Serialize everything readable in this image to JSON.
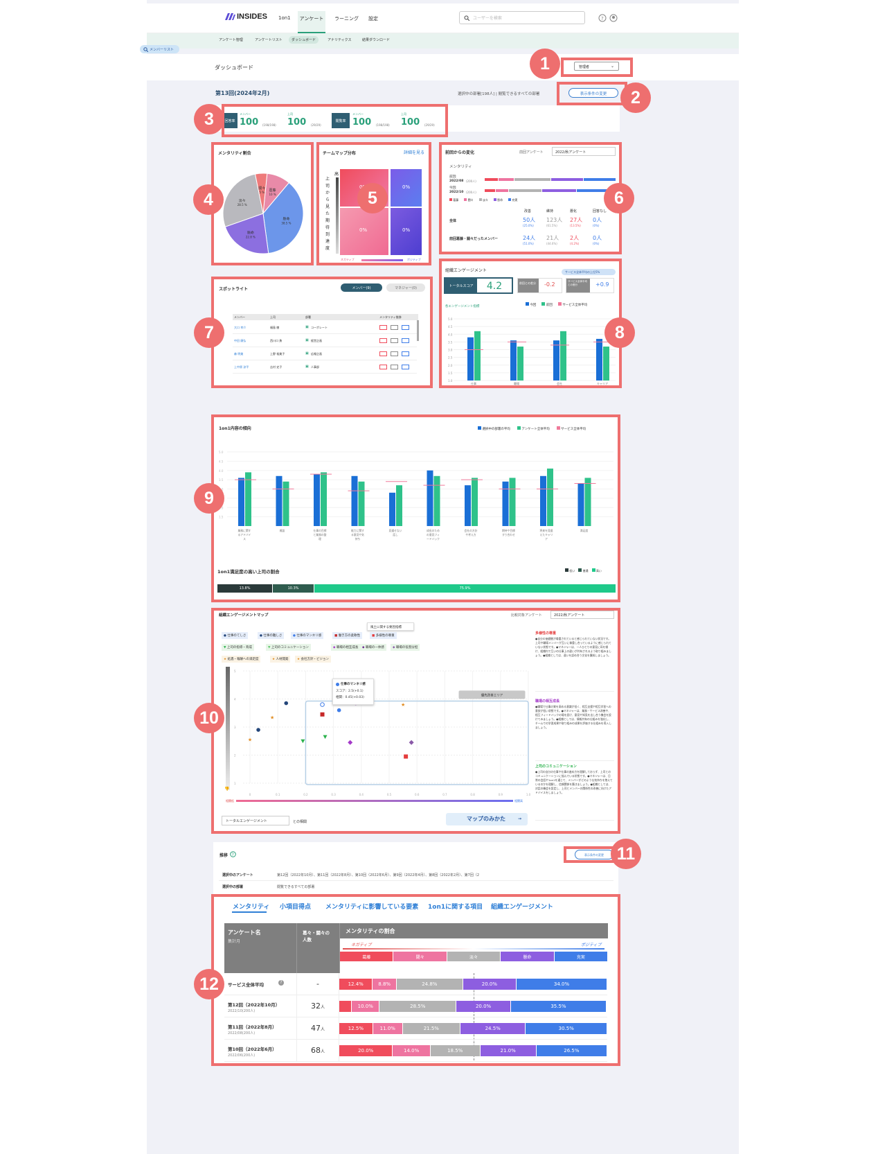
{
  "header": {
    "logo_text": "INSIDES",
    "tabs": [
      "1on1",
      "アンケート",
      "ラーニング",
      "設定"
    ],
    "search_placeholder": "ユーザーを検索"
  },
  "subnav": [
    "アンケート管理",
    "アンケートリスト",
    "ダッシュボード",
    "アナリティクス",
    "結果ダウンロード"
  ],
  "member_list_btn": "メンバーリスト",
  "page_title": "ダッシュボード",
  "role_select": "管理者",
  "survey_round": "第13回(2024年2月)",
  "selection_info": "選択中の部署[198人] | 閲覧できるすべての部署",
  "change_conditions": "表示条件の変更",
  "rates": [
    {
      "label": "回答率",
      "member": "メンバー",
      "member_val": "100",
      "member_sub": "(198/198)",
      "boss": "上司",
      "boss_val": "100",
      "boss_sub": "(29/29)"
    },
    {
      "label": "閲覧率",
      "member": "メンバー",
      "member_val": "100",
      "member_sub": "(198/198)",
      "boss": "上司",
      "boss_val": "100",
      "boss_sub": "(29/29)"
    }
  ],
  "mentality": {
    "title": "メンタリティ割合",
    "slices": [
      {
        "label": "葛藤",
        "value": 10.0,
        "color": "#e88aa8"
      },
      {
        "label": "懸命",
        "value": 38.5,
        "color": "#6c96ea"
      },
      {
        "label": "懸命",
        "value": 22.8,
        "color": "#8c6fe0"
      },
      {
        "label": "淡々",
        "value": 28.5,
        "color": "#b9b9be"
      },
      {
        "label": "闘々",
        "value": 5.0,
        "color": "#ee7a7a"
      }
    ]
  },
  "teammap": {
    "title": "チームマップ分布",
    "link": "詳細を見る",
    "y_label": "上司から見た期待到達度",
    "y_high": "高",
    "cells": [
      "0%",
      "0%",
      "0%",
      "0%"
    ],
    "neg": "ネガティブ",
    "pos": "ポジティブ"
  },
  "change": {
    "title": "前回からの変化",
    "prev_label": "前回アンケート",
    "prev_val": "2022/秋アンケート",
    "ment": "メンタリティ",
    "prev_row": "前回:",
    "prev_date": "2022/08",
    "prev_n": "(200人)",
    "cur_row": "今回:",
    "cur_date": "2022/10",
    "cur_n": "(200人)",
    "legend": [
      "葛藤",
      "闘々",
      "淡々",
      "懸命",
      "充実"
    ],
    "cols": [
      "改善",
      "維持",
      "悪化",
      "回答なし"
    ],
    "rows": [
      {
        "name": "全体",
        "vals": [
          "50人",
          "123人",
          "27人",
          "0人"
        ],
        "subs": [
          "(25.0%)",
          "(61.5%)",
          "(13.5%)",
          "(0%)"
        ]
      },
      {
        "name": "前回葛藤・闘々だったメンバー",
        "vals": [
          "24人",
          "21人",
          "2人",
          "0人"
        ],
        "subs": [
          "(51.0%)",
          "(44.6%)",
          "(4.2%)",
          "(0%)"
        ]
      }
    ]
  },
  "spotlight": {
    "title": "スポットライト",
    "tabs": [
      "メンバー(9)",
      "マネジャー(0)"
    ],
    "cols": [
      "メンバー",
      "上司",
      "部署",
      "メンタリティ推移"
    ],
    "rows": [
      [
        "大口 幸介",
        "福島 徹",
        "コーポレート"
      ],
      [
        "中田 康弘",
        "西川口 勇",
        "経営企画"
      ],
      [
        "森 明美",
        "上野 裕美子",
        "広報企画"
      ],
      [
        "上中原 涼平",
        "吉村 史子",
        "人事部"
      ]
    ]
  },
  "engagement": {
    "title": "組織エンゲージメント",
    "badge": "サービス全体平均の上位5%",
    "total_label": "トータルスコア",
    "total": "4.2",
    "diff1_label": "前回との差分",
    "diff1": "-0.2",
    "diff2_label": "サービス全体平均との差分",
    "diff2": "+0.9",
    "sub": "各エンゲージメント指標",
    "legend": [
      "今回",
      "前回",
      "サービス全体平均"
    ],
    "categories": [
      "仕事",
      "職場",
      "会社",
      "キャリア"
    ],
    "cur": [
      3.8,
      3.6,
      3.6,
      3.7
    ],
    "prev": [
      4.2,
      3.2,
      4.2,
      3.2
    ],
    "avg": [
      3.0,
      3.5,
      3.3,
      3.5
    ],
    "yticks": [
      "5.0",
      "4.5",
      "4.0",
      "3.5",
      "3.0",
      "2.5",
      "2.0",
      "1.5",
      "1.0"
    ]
  },
  "trend": {
    "title": "1on1内容の傾向",
    "legend": [
      "選択中の部署の平均",
      "アンケート全体平均",
      "サービス全体平均"
    ],
    "yticks": [
      "5.0",
      "4.5",
      "4.0",
      "3.5",
      "3.0",
      "2.5",
      "2.0",
      "1.5"
    ],
    "categories": [
      "業務に関するアドバイス",
      "雑談",
      "仕事の目標と業務の整理",
      "能力に関する意見や気持ち",
      "見通せない話し",
      "成長のための意見フィードバック",
      "会社の方針や考え方",
      "期待や目標すり合わせ",
      "将来を見据えたキャリア",
      "満足度"
    ],
    "dept": [
      3.6,
      3.7,
      3.8,
      3.7,
      2.8,
      4.0,
      3.2,
      3.4,
      3.7,
      3.3
    ],
    "survey": [
      3.9,
      3.4,
      3.9,
      3.4,
      3.2,
      3.7,
      3.6,
      3.6,
      4.1,
      3.6
    ],
    "avg": [
      3.5,
      3.0,
      3.8,
      2.9,
      3.4,
      3.2,
      3.5,
      3.0,
      3.0,
      3.3
    ],
    "sat_title": "1on1満足度の高い上司の割合",
    "sat_legend": [
      "低い",
      "普通",
      "高い"
    ],
    "sat": [
      {
        "label": "13.8%",
        "val": 13.8,
        "color": "#2b3a3a"
      },
      {
        "label": "10.3%",
        "val": 10.3,
        "color": "#2f5c4e"
      },
      {
        "label": "75.9%",
        "val": 75.9,
        "color": "#1fc98a"
      }
    ]
  },
  "engmap": {
    "title": "組織エンゲージメントマップ",
    "cmp_label": "比較対象アンケート",
    "cmp_val": "2022/秋アンケート",
    "tip_top": "風土に関する要因指標",
    "legend_row1": [
      "仕事のてしさ",
      "仕事の難しさ",
      "仕事のマンネリ感",
      "働き方の柔軟性",
      "多様性の尊重"
    ],
    "legend_row2": [
      "上司の指導・育成",
      "上司のコミュニケーション",
      "職場の相互成長",
      "職場の一体感",
      "職場の役割分担"
    ],
    "legend_row3": [
      "処遇・報酬への満足度",
      "人材開発",
      "会社方針・ビジョン"
    ],
    "hover_title": "仕事のマンネリ感",
    "hover_score": "スコア：2.5(+0.1)",
    "hover_corr": "相関：0.45(+0.03)",
    "area_label": "優先改善エリア",
    "xticks": [
      "0",
      "0.1",
      "0.2",
      "0.3",
      "0.4",
      "0.5",
      "0.6",
      "0.7",
      "0.8",
      "0.9",
      "1.0"
    ],
    "yticks": [
      "5",
      "4",
      "3",
      "2",
      "1"
    ],
    "x_low": "相関低",
    "x_high": "相関高",
    "select": "トータルエンゲージメント",
    "select_suffix": "との相関",
    "guide_btn": "マップのみかた",
    "side": [
      {
        "title": "多様性の尊重",
        "color": "#e43d3d",
        "text": "●自分の価値観が尊重されていると感じられていない状況です。上司や職場メンバーが互いに尊重し合っているように感じられていない状態です。●マネジャーは、一人ひとりの意見に耳を傾け、組織内で互いの仕事上の違いが共有されるよう取り組みましょう。●組織としては、違いを認め合う文化を醸成しましょう。"
      },
      {
        "title": "職場の相互成長",
        "color": "#a43ac9",
        "text": "●職場で仕事の質を高める意識が低く、相互支援や相互学習への意欲が低い状態です。●マネジャーは、業務・サービス改善や、相互フィードバックの場を設け、意見や知見を出し合う機会を設けてみましょう。●組織としては、情報共有の仕組みを強化し、チームでの学習成果や取り組みの成果を評価する仕組みを導入しましょう。"
      },
      {
        "title": "上司のコミュニケーション",
        "color": "#2bb24c",
        "text": "●上司の自分の仕事や仕事の進め方を理解しておらず、上司とのコミュニケーションに悩んでいる状態です。●マネジャーは、日常の会話や1on1を通じて、メンバーがどのような気持ちを抱えているのかを理解し、信頼関係を築きましょう。●組織としては、対話の機会を設定し、上司とメンバーの関係性の改善に向けたアドバイスをしましょう。"
      }
    ]
  },
  "transition": {
    "title": "推移",
    "change_btn": "表示条件の変更",
    "survey_label": "選択中のアンケート",
    "survey_val": "第12回（2022年10月）、第11回（2022年8月）、第10回（2022年6月）、第9回（2022年4月）、第8回（2022年2月）、第7回（2",
    "dept_label": "選択中の部署",
    "dept_val": "閲覧できるすべての部署"
  },
  "detail": {
    "tabs": [
      "メンタリティ",
      "小項目得点",
      "メンタリティに影響している要素",
      "1on1に関する項目",
      "組織エンゲージメント"
    ],
    "col1": "アンケート名",
    "col1_sub": "集計月",
    "col2": "葛々・闘々の人数",
    "col3": "メンタリティの割合",
    "neg": "ネガティブ",
    "pos": "ポジティブ",
    "cats": [
      "葛藤",
      "闘々",
      "淡々",
      "懸命",
      "充実"
    ],
    "cat_colors": [
      "#f04c5c",
      "#ee74a0",
      "#b3b3b3",
      "#8d5ee0",
      "#3f7de8"
    ],
    "rows": [
      {
        "name": "サービス全体平均",
        "sub": "",
        "count": "-",
        "vals": [
          12.4,
          8.8,
          24.8,
          20.0,
          34.0
        ],
        "labels": [
          "12.4%",
          "8.8%",
          "24.8%",
          "20.0%",
          "34.0%"
        ]
      },
      {
        "name": "第12回（2022年10月）",
        "sub": "2022/10(200人)",
        "count": "32",
        "vals": [
          4.5,
          10.0,
          28.5,
          20.0,
          35.5
        ],
        "labels": [
          "",
          "10.0%",
          "28.5%",
          "20.0%",
          "35.5%"
        ]
      },
      {
        "name": "第11回（2022年8月）",
        "sub": "2022/08(200人)",
        "count": "47",
        "vals": [
          12.5,
          11.0,
          21.5,
          24.5,
          30.5
        ],
        "labels": [
          "12.5%",
          "11.0%",
          "21.5%",
          "24.5%",
          "30.5%"
        ]
      },
      {
        "name": "第10回（2022年6月）",
        "sub": "2022/06(200人)",
        "count": "68",
        "vals": [
          20.0,
          14.0,
          18.5,
          21.0,
          26.5
        ],
        "labels": [
          "20.0%",
          "14.0%",
          "18.5%",
          "21.0%",
          "26.5%"
        ]
      }
    ],
    "unit": "人"
  },
  "badges": [
    "1",
    "2",
    "3",
    "4",
    "5",
    "6",
    "7",
    "8",
    "9",
    "10",
    "11",
    "12"
  ]
}
